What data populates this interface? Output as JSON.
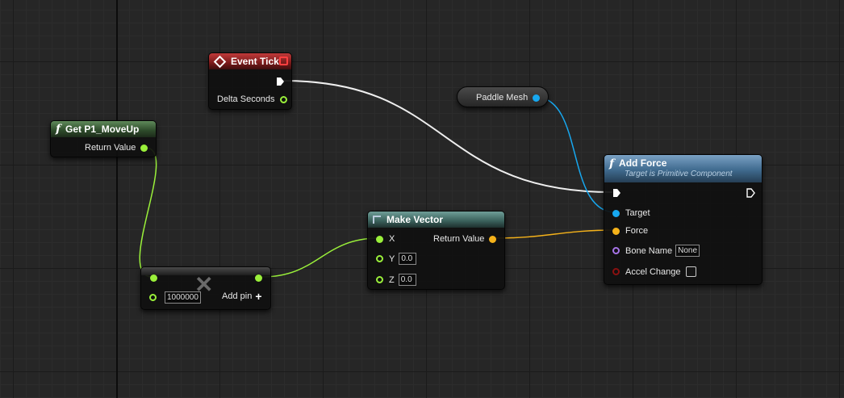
{
  "colors": {
    "exec_wire": "#eeeeee",
    "float_wire": "#9af03a",
    "object_wire": "#17a8f0",
    "vector_wire": "#f5b21a"
  },
  "nodes": {
    "event_tick": {
      "title": "Event Tick",
      "delta_seconds": "Delta Seconds"
    },
    "get_p1_moveup": {
      "title": "Get P1_MoveUp",
      "return_value": "Return Value"
    },
    "multiply": {
      "b_value": "1000000",
      "add_pin": "Add pin",
      "op_symbol": "✕"
    },
    "make_vector": {
      "title": "Make Vector",
      "x": "X",
      "y": "Y",
      "y_value": "0.0",
      "z": "Z",
      "z_value": "0.0",
      "return_value": "Return Value"
    },
    "paddle_mesh": {
      "label": "Paddle Mesh"
    },
    "add_force": {
      "title": "Add Force",
      "subtitle": "Target is Primitive Component",
      "target": "Target",
      "force": "Force",
      "bone_name": "Bone Name",
      "bone_name_value": "None",
      "accel_change": "Accel Change"
    }
  }
}
